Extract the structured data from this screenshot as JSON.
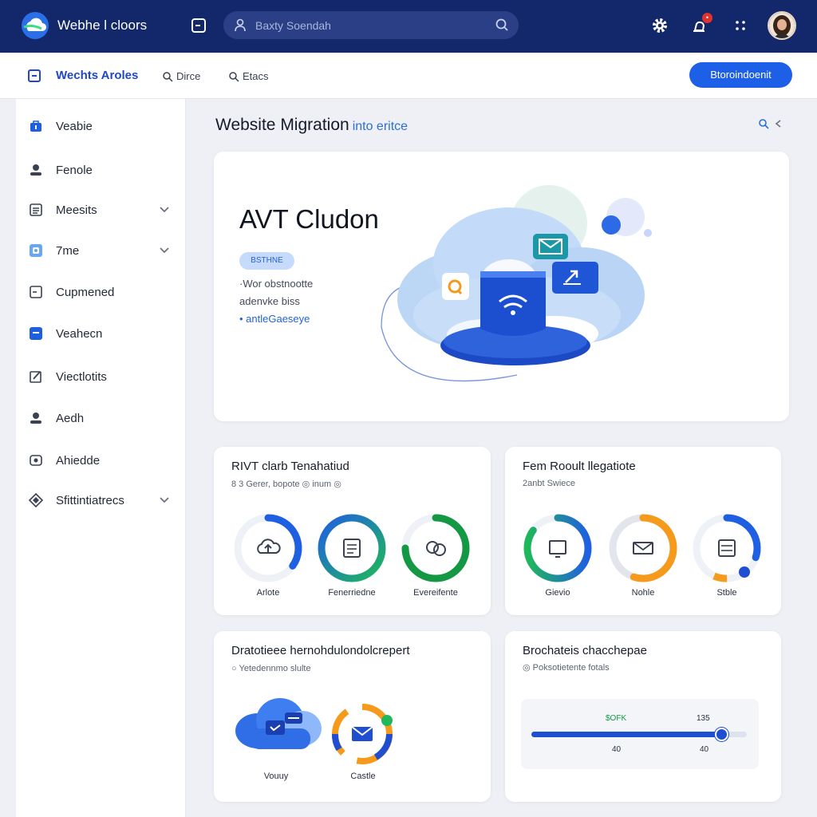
{
  "topbar": {
    "app_title": "Webhe l cloors",
    "search_placeholder": "Baxty Soendah"
  },
  "subheader": {
    "title": "Wechts Aroles",
    "links": [
      "Dirce",
      "Etacs"
    ],
    "primary_button": "Btoroindoenit"
  },
  "sidebar": {
    "items": [
      {
        "label": "Veabie",
        "icon": "bag-icon",
        "chevron": false
      },
      {
        "label": "Fenole",
        "icon": "person-icon",
        "chevron": false
      },
      {
        "label": "Meesits",
        "icon": "list-icon",
        "chevron": true
      },
      {
        "label": "7me",
        "icon": "image-icon",
        "chevron": true
      },
      {
        "label": "Cupmened",
        "icon": "minus-box-icon",
        "chevron": false
      },
      {
        "label": "Veahecn",
        "icon": "check-box-icon",
        "chevron": false
      },
      {
        "label": "Viectlotits",
        "icon": "edit-icon",
        "chevron": false
      },
      {
        "label": "Aedh",
        "icon": "user-icon",
        "chevron": false
      },
      {
        "label": "Ahiedde",
        "icon": "camera-icon",
        "chevron": false
      },
      {
        "label": "Sfittintiatrecs",
        "icon": "diamond-icon",
        "chevron": true
      }
    ]
  },
  "page": {
    "title": "Website Migration",
    "title_suffix": "into eritce"
  },
  "hero": {
    "title": "AVT Cludon",
    "badge": "BSTHNE",
    "line1": "·Wor obstnootte",
    "line2": "adenvke biss",
    "link": "• antleGaeseye"
  },
  "card_status": {
    "title": "RIVT clarb Tenahatiud",
    "subtitle": "8 3 Gerer, bopote ◎ inum ◎",
    "rings": [
      {
        "label": "Arlote",
        "icon": "cloud-upload-icon",
        "progress": 0.35
      },
      {
        "label": "Fenerriedne",
        "icon": "document-icon",
        "progress": 1.0
      },
      {
        "label": "Evereifente",
        "icon": "chat-icon",
        "progress": 0.75
      }
    ]
  },
  "card_migration": {
    "title": "Fem Rooult llegatiote",
    "subtitle": "2anbt Swiece",
    "rings": [
      {
        "label": "Gievio",
        "icon": "monitor-icon",
        "progress": 0.85
      },
      {
        "label": "Nohle",
        "icon": "mail-icon",
        "progress": 0.55
      },
      {
        "label": "Stble",
        "icon": "server-icon",
        "progress": 0.3
      }
    ]
  },
  "card_transfer": {
    "title": "Dratotieee hernohdulondolcrepert",
    "subtitle": "○ Yetedennmo slulte",
    "items": [
      {
        "label": "Vouuy",
        "icon": "cloud-chat-icon"
      },
      {
        "label": "Castle",
        "icon": "mail-ring-icon"
      }
    ]
  },
  "card_progress": {
    "title": "Brochateis chacchepae",
    "subtitle": "◎ Poksotietente fotals",
    "top_left": "$OFK",
    "top_right": "135",
    "bottom_left": "40",
    "bottom_right": "40",
    "progress": 0.88
  },
  "colors": {
    "topbar": "#13286a",
    "accent": "#1d5fe6",
    "green": "#1aa84f",
    "orange": "#f59a1b"
  }
}
